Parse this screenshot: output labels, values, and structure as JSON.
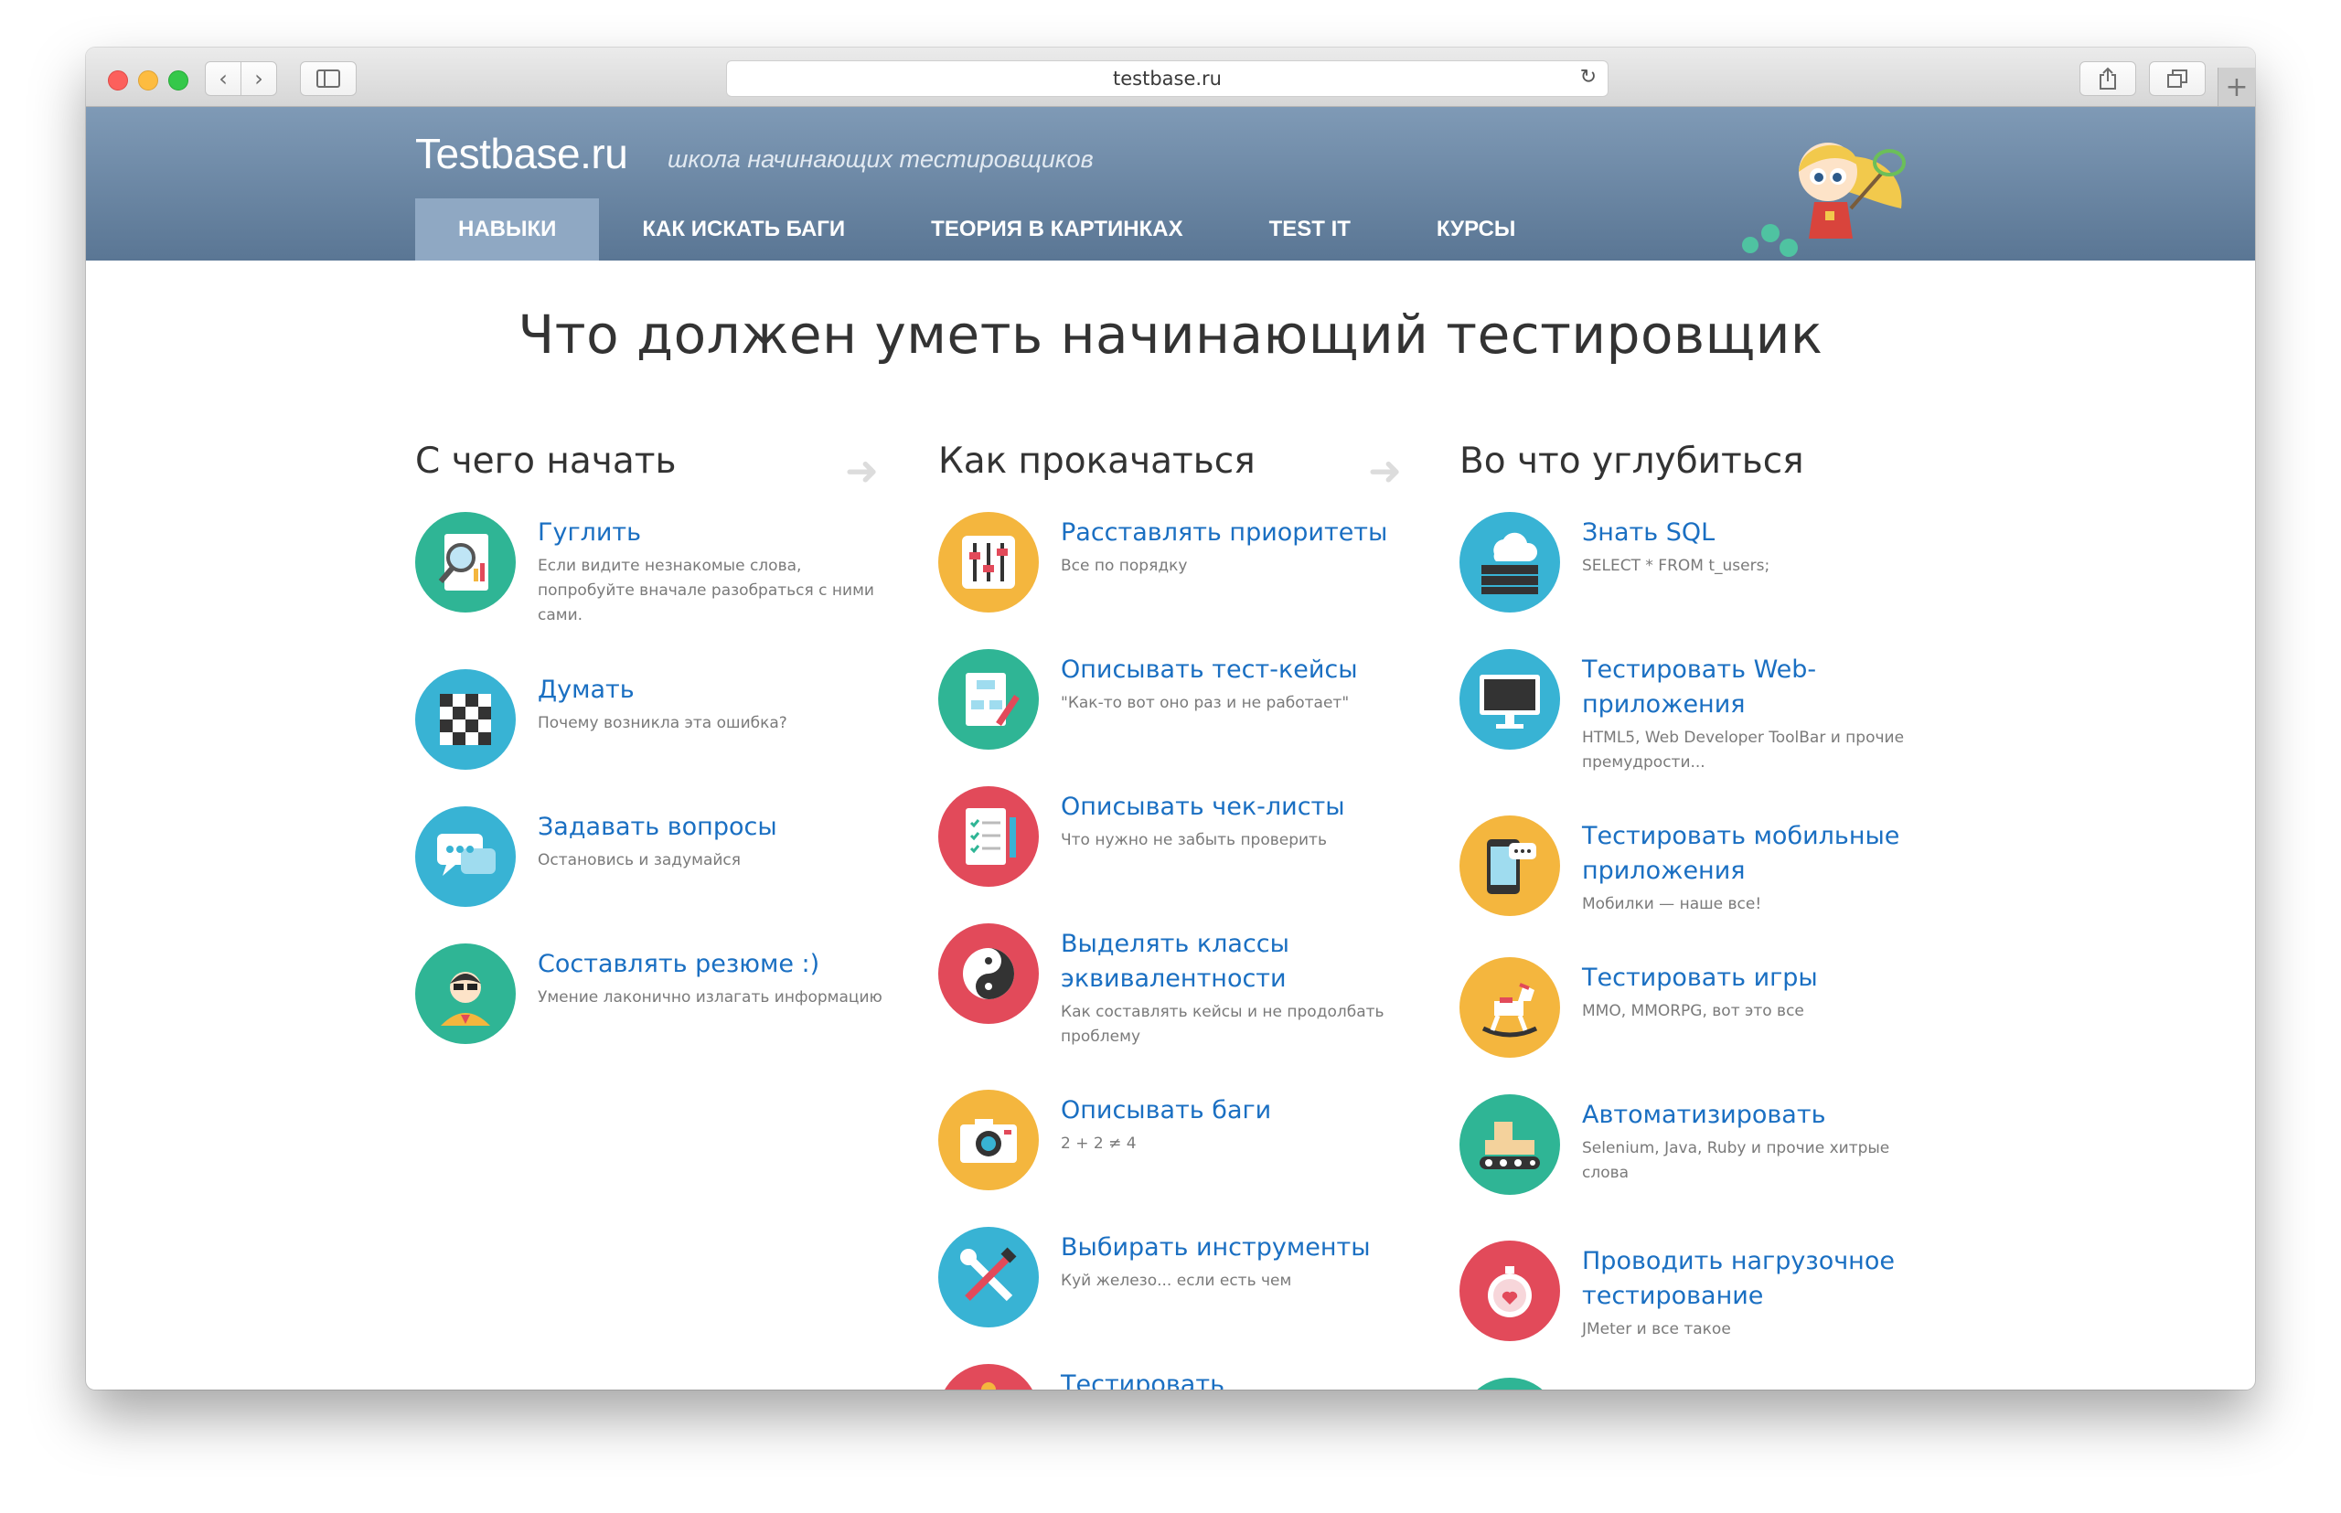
{
  "browser": {
    "url": "testbase.ru"
  },
  "site": {
    "logo": "Testbase.ru",
    "tagline": "школа начинающих тестировщиков",
    "menu": [
      "НАВЫКИ",
      "КАК ИСКАТЬ БАГИ",
      "ТЕОРИЯ В КАРТИНКАХ",
      "TEST IT",
      "КУРСЫ"
    ],
    "active_menu": "НАВЫКИ"
  },
  "headline": "Что должен уметь начинающий тестировщик",
  "columns": [
    {
      "title": "С чего начать",
      "items": [
        {
          "title": "Гуглить",
          "desc": "Если видите незнакомые слова, попробуйте вначале разобраться с ними сами.",
          "icon": "search-chart-icon",
          "color": "#2fb595"
        },
        {
          "title": "Думать",
          "desc": "Почему возникла эта ошибка?",
          "icon": "chess-board-icon",
          "color": "#38b3d4"
        },
        {
          "title": "Задавать вопросы",
          "desc": "Остановись и задумайся",
          "icon": "chat-bubbles-icon",
          "color": "#38b3d4"
        },
        {
          "title": "Составлять резюме :)",
          "desc": "Умение лаконично излагать информацию",
          "icon": "person-avatar-icon",
          "color": "#2fb595"
        }
      ]
    },
    {
      "title": "Как прокачаться",
      "items": [
        {
          "title": "Расставлять приоритеты",
          "desc": "Все по порядку",
          "icon": "sliders-icon",
          "color": "#f4b63e"
        },
        {
          "title": "Описывать тест-кейсы",
          "desc": "\"Как-то вот оно раз и не работает\"",
          "icon": "flowchart-pencil-icon",
          "color": "#2fb595"
        },
        {
          "title": "Описывать чек-листы",
          "desc": "Что нужно не забыть проверить",
          "icon": "checklist-icon",
          "color": "#e24a5a"
        },
        {
          "title": "Выделять классы эквивалентности",
          "desc": "Как составлять кейсы и не продолбать проблему",
          "icon": "yin-yang-icon",
          "color": "#e24a5a"
        },
        {
          "title": "Описывать баги",
          "desc": "2 + 2 ≠ 4",
          "icon": "camera-icon",
          "color": "#f4b63e"
        },
        {
          "title": "Выбирать инструменты",
          "desc": "Куй железо... если есть чем",
          "icon": "wrench-screwdriver-icon",
          "color": "#38b3d4"
        },
        {
          "title": "Тестировать документацию",
          "desc": "",
          "icon": "document-icon",
          "color": "#e24a5a"
        }
      ]
    },
    {
      "title": "Во что углубиться",
      "items": [
        {
          "title": "Знать SQL",
          "desc": "SELECT * FROM t_users;",
          "icon": "cloud-database-icon",
          "color": "#38b3d4"
        },
        {
          "title": "Тестировать Web-приложения",
          "desc": "HTML5, Web Developer ToolBar и прочие премудрости...",
          "icon": "monitor-icon",
          "color": "#38b3d4"
        },
        {
          "title": "Тестировать мобильные приложения",
          "desc": "Мобилки — наше все!",
          "icon": "smartphone-icon",
          "color": "#f4b63e"
        },
        {
          "title": "Тестировать игры",
          "desc": "MMO, MMORPG, вот это все",
          "icon": "rocking-horse-icon",
          "color": "#f4b63e"
        },
        {
          "title": "Автоматизировать",
          "desc": "Selenium, Java, Ruby и прочие хитрые слова",
          "icon": "conveyor-icon",
          "color": "#2fb595"
        },
        {
          "title": "Проводить нагрузочное тестирование",
          "desc": "JMeter и все такое",
          "icon": "stopwatch-icon",
          "color": "#e24a5a"
        },
        {
          "title": "",
          "desc": "",
          "icon": "partial-icon",
          "color": "#2fb595"
        }
      ]
    }
  ]
}
